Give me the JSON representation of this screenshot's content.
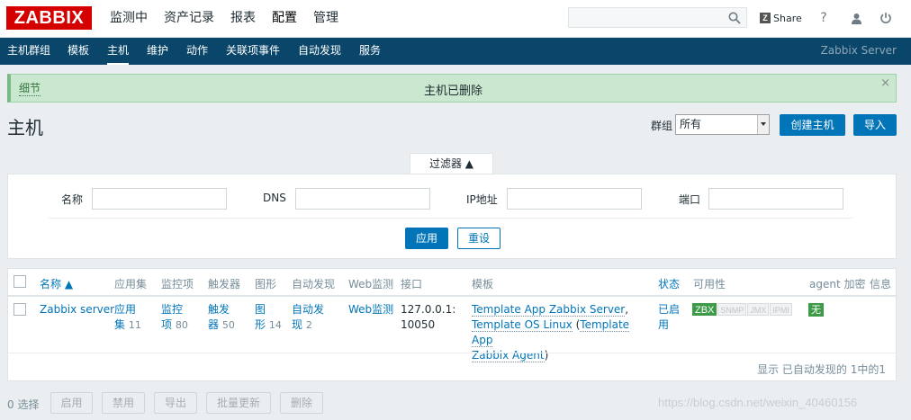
{
  "header": {
    "logo": "ZABBIX",
    "menu": [
      "监测中",
      "资产记录",
      "报表",
      "配置",
      "管理"
    ],
    "search": {
      "value": "",
      "placeholder": ""
    },
    "share_label": "Share",
    "help_icon": "question-icon",
    "user_icon": "user-icon",
    "logout_icon": "power-icon"
  },
  "subnav": {
    "items": [
      "主机群组",
      "模板",
      "主机",
      "维护",
      "动作",
      "关联项事件",
      "自动发现",
      "服务"
    ],
    "server_name": "Zabbix Server"
  },
  "message": {
    "details_label": "细节",
    "text": "主机已删除",
    "close": "×"
  },
  "page": {
    "title": "主机",
    "group_label": "群组",
    "group_value": "所有",
    "create_button": "创建主机",
    "import_button": "导入"
  },
  "filter": {
    "tab_label": "过滤器 ▲",
    "name_label": "名称",
    "name_value": "",
    "dns_label": "DNS",
    "dns_value": "",
    "ip_label": "IP地址",
    "ip_value": "",
    "port_label": "端口",
    "port_value": "",
    "apply_button": "应用",
    "reset_button": "重设"
  },
  "table": {
    "headers": {
      "name": "名称 ▲",
      "applications": "应用集",
      "items": "监控项",
      "triggers": "触发器",
      "graphs": "图形",
      "discovery": "自动发现",
      "web": "Web监测",
      "interface": "接口",
      "templates": "模板",
      "status": "状态",
      "availability": "可用性",
      "encryption": "agent 加密",
      "info": "信息"
    },
    "rows": [
      {
        "name": "Zabbix server",
        "applications_l1": "应用",
        "applications_l2": "集",
        "applications_count": "11",
        "items_l1": "监控",
        "items_l2": "项",
        "items_count": "80",
        "triggers_l1": "触发",
        "triggers_l2": "器",
        "triggers_count": "50",
        "graphs_l1": "图",
        "graphs_l2": "形",
        "graphs_count": "14",
        "discovery_l1": "自动发",
        "discovery_l2": "现",
        "discovery_count": "2",
        "web": "Web监测",
        "interface_l1": "127.0.0.1:",
        "interface_l2": "10050",
        "template_1": "Template App Zabbix Server",
        "sep_1": ",",
        "template_2": "Template OS Linux",
        "paren_open": " (",
        "template_3a": "Template App",
        "template_3b": "Zabbix Agent",
        "paren_close": ")",
        "status_l1": "已启",
        "status_l2": "用",
        "avail_zbx": "ZBX",
        "avail_snmp": "SNMP",
        "avail_jmx": "JMX",
        "avail_ipmi": "IPMI",
        "encryption": "无"
      }
    ],
    "footer": "显示 已自动发现的 1中的1"
  },
  "actions": {
    "selected": "0 选择",
    "enable": "启用",
    "disable": "禁用",
    "export": "导出",
    "mass_update": "批量更新",
    "delete": "删除"
  },
  "watermark": "https://blog.csdn.net/weixin_40460156",
  "colors": {
    "header_bg": "#ffffff",
    "subnav_bg": "#0a466a",
    "accent": "#0275b8",
    "logo_red": "#d40000",
    "success_bg": "#cae7cf",
    "ok_green": "#3d9a47"
  }
}
